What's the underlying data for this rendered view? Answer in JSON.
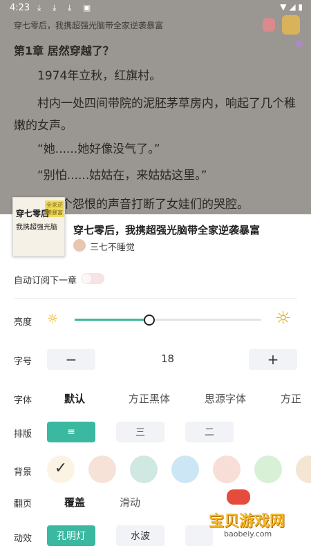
{
  "status_bar": {
    "time": "4:23",
    "dl_icons": [
      "download-icon",
      "download-icon",
      "download-icon",
      "download-icon",
      "app-icon"
    ]
  },
  "reader": {
    "book_title_top": "穿七零后，我携超强光脑带全家逆袭暴富",
    "chapter_title": "第1章 居然穿越了？",
    "paragraphs": [
      "　　1974年立秋，红旗村。",
      "　　村内一处四间带院的泥胚茅草房内，响起了几个稚嫩的女声。",
      "　　“她......她好像没气了。”",
      "　　“别怕......姑姑在，来姑姑这里。”",
      "　　，一个怨恨的声音打断了女娃们的哭腔。"
    ]
  },
  "book": {
    "cover_title1": "穿七零后",
    "cover_title2": "我携超强光脑",
    "cover_tag": "全家逆袭暴富",
    "name": "穿七零后，我携超强光脑带全家逆袭暴富",
    "author": "三七不睡觉"
  },
  "settings": {
    "auto_subscribe_label": "自动订阅下一章",
    "auto_subscribe_on": false,
    "brightness_label": "亮度",
    "brightness_value": 0.4,
    "font_size_label": "字号",
    "font_size_value": "18",
    "minus": "−",
    "plus": "+",
    "font_label": "字体",
    "fonts": [
      "默认",
      "方正黑体",
      "思源字体",
      "方正"
    ],
    "layout_label": "排版",
    "layouts": [
      "≡",
      "三",
      "二"
    ],
    "background_label": "背景",
    "background_colors": [
      "#fbf3e4",
      "#f7e2d7",
      "#cfe8e2",
      "#cde6f6",
      "#f7dfd7",
      "#d7f0d6",
      "#f4e6d2"
    ],
    "page_turn_label": "翻页",
    "page_turns": [
      "覆盖",
      "滑动"
    ],
    "effect_label": "动效",
    "effects": [
      "孔明灯",
      "水波",
      ""
    ]
  },
  "watermark": {
    "title": "宝贝游戏网",
    "url": "baobeiy.com"
  },
  "colors": {
    "accent": "#3bb8a0",
    "sun": "#e6a817"
  }
}
